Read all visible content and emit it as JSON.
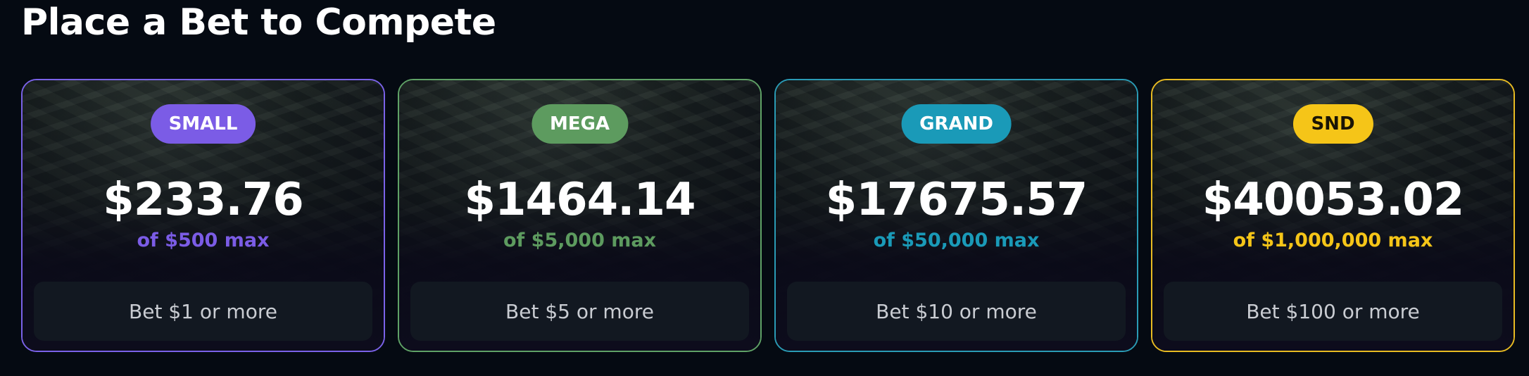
{
  "page_title": "Place a Bet to Compete",
  "cards": [
    {
      "badge": "SMALL",
      "amount": "$233.76",
      "max_text": "of $500 max",
      "button_label": "Bet $1 or more",
      "accent_color": "#7b5ce6",
      "border_color": "#7a62e8"
    },
    {
      "badge": "MEGA",
      "amount": "$1464.14",
      "max_text": "of $5,000 max",
      "button_label": "Bet $5 or more",
      "accent_color": "#5d9b5f",
      "border_color": "#5fa266"
    },
    {
      "badge": "GRAND",
      "amount": "$17675.57",
      "max_text": "of $50,000 max",
      "button_label": "Bet $10 or more",
      "accent_color": "#1a9ab8",
      "border_color": "#2a9bb5"
    },
    {
      "badge": "SND",
      "amount": "$40053.02",
      "max_text": "of $1,000,000 max",
      "button_label": "Bet $100 or more",
      "accent_color": "#f5c518",
      "border_color": "#e8bb22"
    }
  ]
}
